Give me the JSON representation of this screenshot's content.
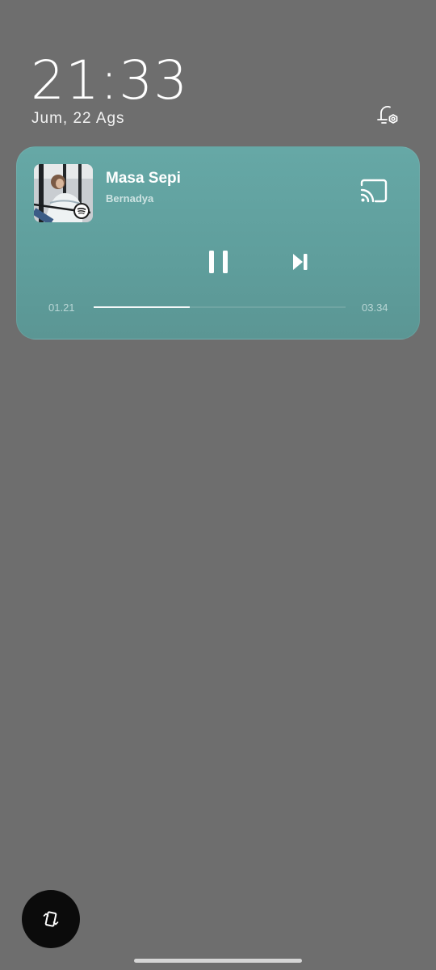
{
  "lockscreen": {
    "time": "21:33",
    "date": "Jum, 22 Ags"
  },
  "media": {
    "title": "Masa Sepi",
    "artist": "Bernadya",
    "elapsed": "01.21",
    "duration": "03.34",
    "progress_fraction": 0.38,
    "source_app_icon": "spotify-icon",
    "card_color": "#64a6a4"
  },
  "icons": {
    "notification_settings": "bell-gear-icon",
    "cast": "cast-icon",
    "pause": "pause-icon",
    "next": "skip-next-icon",
    "rotate": "screen-rotate-icon"
  }
}
